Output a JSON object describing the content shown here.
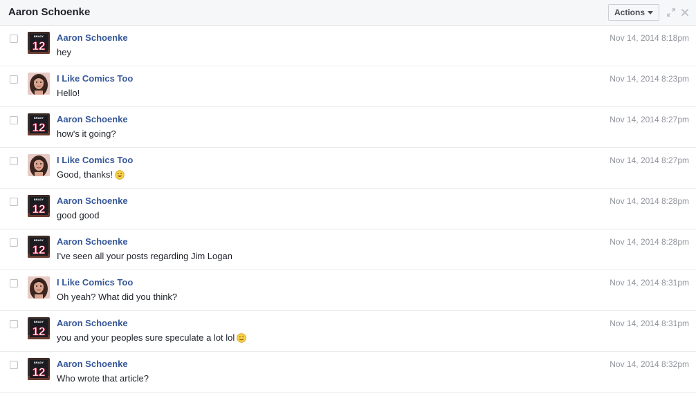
{
  "header": {
    "title": "Aaron Schoenke",
    "actions_label": "Actions",
    "expand_icon": "expand-icon",
    "close_icon": "close-icon"
  },
  "avatars": {
    "aaron": {
      "jersey_text": "12",
      "name_text": "BRADY"
    },
    "comics": {}
  },
  "colors": {
    "sender_link": "#365899",
    "timestamp": "#90949c",
    "header_bg": "#f6f7f9"
  },
  "messages": [
    {
      "sender": "Aaron Schoenke",
      "avatar": "aaron",
      "text": "hey",
      "emoji": "",
      "time": "Nov 14, 2014 8:18pm"
    },
    {
      "sender": "I Like Comics Too",
      "avatar": "comics",
      "text": "Hello!",
      "emoji": "",
      "time": "Nov 14, 2014 8:23pm"
    },
    {
      "sender": "Aaron Schoenke",
      "avatar": "aaron",
      "text": "how's it going?",
      "emoji": "",
      "time": "Nov 14, 2014 8:27pm"
    },
    {
      "sender": "I Like Comics Too",
      "avatar": "comics",
      "text": "Good, thanks!",
      "emoji": "grinning-face",
      "time": "Nov 14, 2014 8:27pm"
    },
    {
      "sender": "Aaron Schoenke",
      "avatar": "aaron",
      "text": "good good",
      "emoji": "",
      "time": "Nov 14, 2014 8:28pm"
    },
    {
      "sender": "Aaron Schoenke",
      "avatar": "aaron",
      "text": "I've seen all your posts regarding Jim Logan",
      "emoji": "",
      "time": "Nov 14, 2014 8:28pm"
    },
    {
      "sender": "I Like Comics Too",
      "avatar": "comics",
      "text": "Oh yeah? What did you think?",
      "emoji": "",
      "time": "Nov 14, 2014 8:31pm"
    },
    {
      "sender": "Aaron Schoenke",
      "avatar": "aaron",
      "text": "you and your peoples sure speculate a lot lol",
      "emoji": "smiling-face",
      "time": "Nov 14, 2014 8:31pm"
    },
    {
      "sender": "Aaron Schoenke",
      "avatar": "aaron",
      "text": "Who wrote that article?",
      "emoji": "",
      "time": "Nov 14, 2014 8:32pm"
    }
  ]
}
